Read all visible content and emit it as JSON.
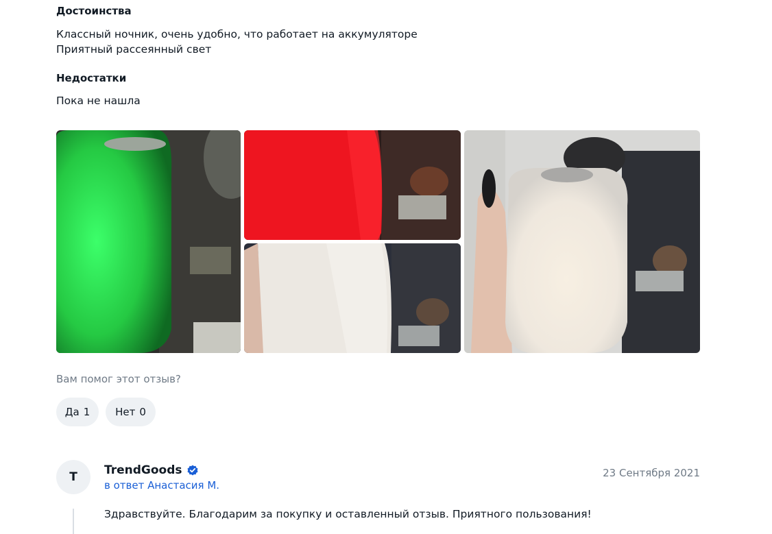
{
  "review": {
    "pros_title": "Достоинства",
    "pros_lines": [
      "Классный ночник, очень удобно, что работает на аккумуляторе",
      "Приятный рассеянный свет"
    ],
    "cons_title": "Недостатки",
    "cons_text": "Пока не нашла"
  },
  "photos": [
    {
      "icon": "photo-green-lamp",
      "accent": "#2fd04f"
    },
    {
      "icon": "photo-red-lamp",
      "accent": "#e8121c"
    },
    {
      "icon": "photo-white-lamp-hand",
      "accent": "#ece8e2"
    },
    {
      "icon": "photo-white-lamp-held",
      "accent": "#f1ece4"
    }
  ],
  "helpful": {
    "question": "Вам помог этот отзыв?",
    "yes_label": "Да",
    "yes_count": "1",
    "no_label": "Нет",
    "no_count": "0"
  },
  "seller_reply": {
    "avatar_letter": "T",
    "author": "TrendGoods",
    "verified_icon": "verified-check-icon",
    "reply_to": "в ответ Анастасия М.",
    "date": "23 Сентября 2021",
    "text": "Здравствуйте. Благодарим за покупку и оставленный отзыв. Приятного пользования!"
  },
  "colors": {
    "text": "#111a24",
    "muted": "#6f7a86",
    "link": "#1a5fd6",
    "button_bg": "#eef1f4",
    "verified": "#1a5fd6"
  }
}
